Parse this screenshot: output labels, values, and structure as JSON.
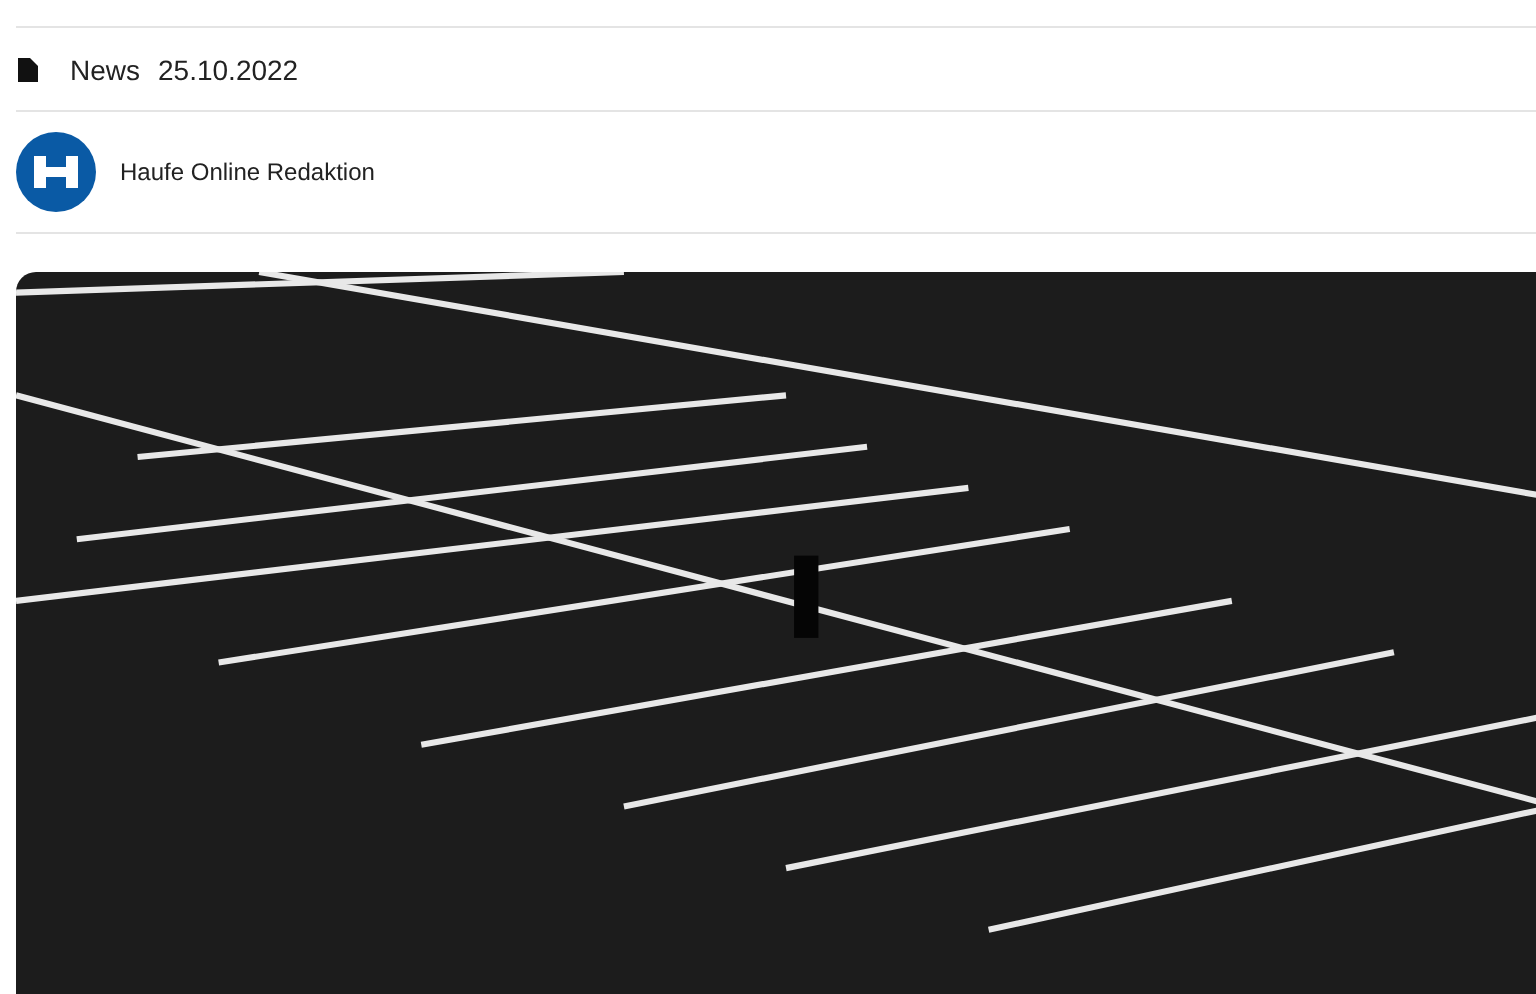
{
  "meta": {
    "type": "News",
    "date": "25.10.2022"
  },
  "author": {
    "name": "Haufe Online Redaktion"
  }
}
